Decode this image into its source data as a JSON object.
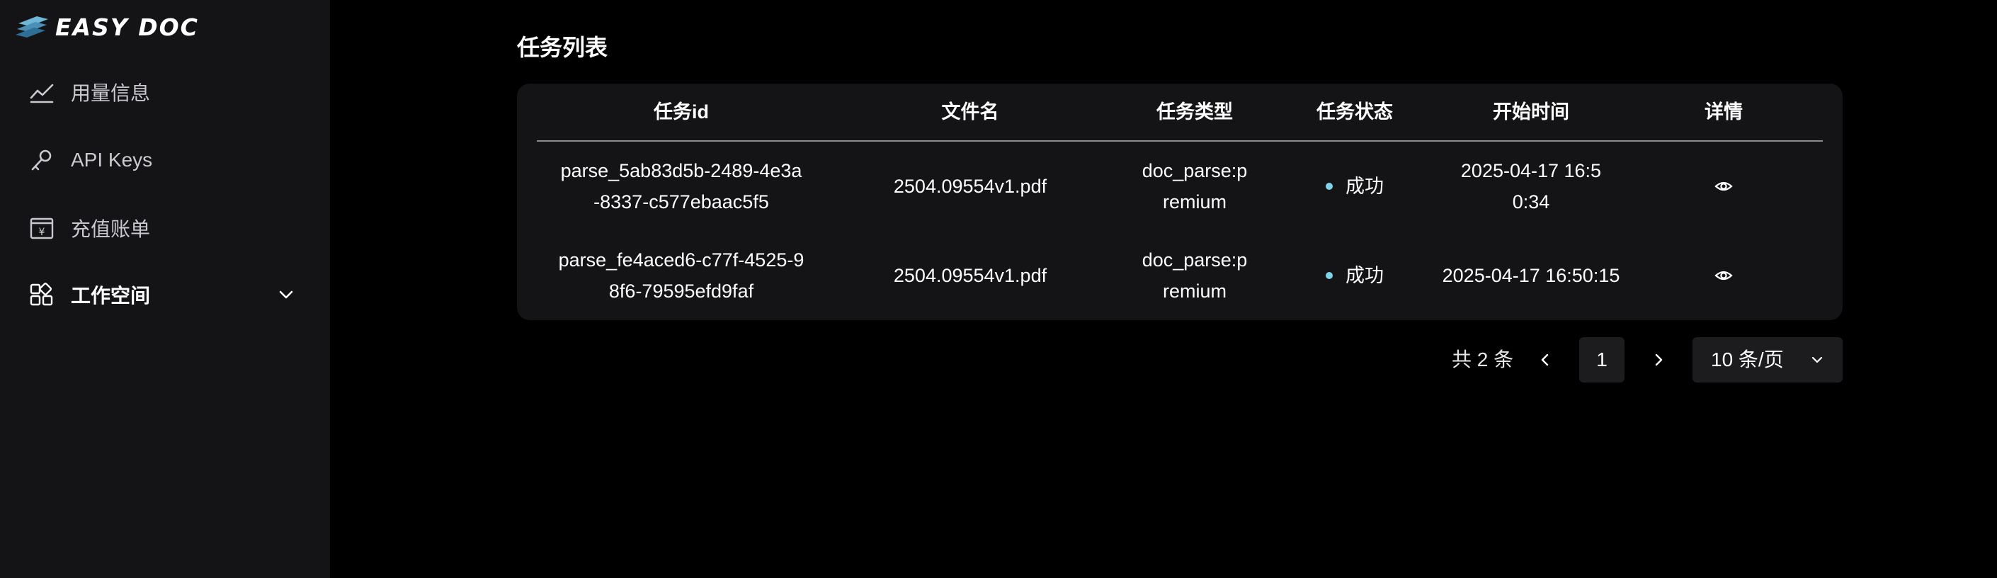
{
  "brand": {
    "name": "EASY DOC"
  },
  "sidebar": {
    "items": [
      {
        "label": "用量信息",
        "icon": "trend-line-icon"
      },
      {
        "label": "API Keys",
        "icon": "key-icon"
      },
      {
        "label": "充值账单",
        "icon": "receipt-yen-icon"
      },
      {
        "label": "工作空间",
        "icon": "grid-apps-icon",
        "active": true,
        "expandable": true
      }
    ]
  },
  "main": {
    "title": "任务列表",
    "table": {
      "columns": [
        "任务id",
        "文件名",
        "任务类型",
        "任务状态",
        "开始时间",
        "详情"
      ],
      "rows": [
        {
          "task_id": "parse_5ab83d5b-2489-4e3a-8337-c577ebaac5f5",
          "file_name": "2504.09554v1.pdf",
          "task_type": "doc_parse:premium",
          "status": "成功",
          "start_time": "2025-04-17 16:50:34"
        },
        {
          "task_id": "parse_fe4aced6-c77f-4525-98f6-79595efd9faf",
          "file_name": "2504.09554v1.pdf",
          "task_type": "doc_parse:premium",
          "status": "成功",
          "start_time": "2025-04-17 16:50:15"
        }
      ]
    },
    "pagination": {
      "total": "共 2 条",
      "current_page": "1",
      "page_size": "10 条/页"
    }
  },
  "colors": {
    "background": "#000000",
    "sidebar": "#141416",
    "card": "#141416",
    "status_success": "#7fd3e9"
  }
}
